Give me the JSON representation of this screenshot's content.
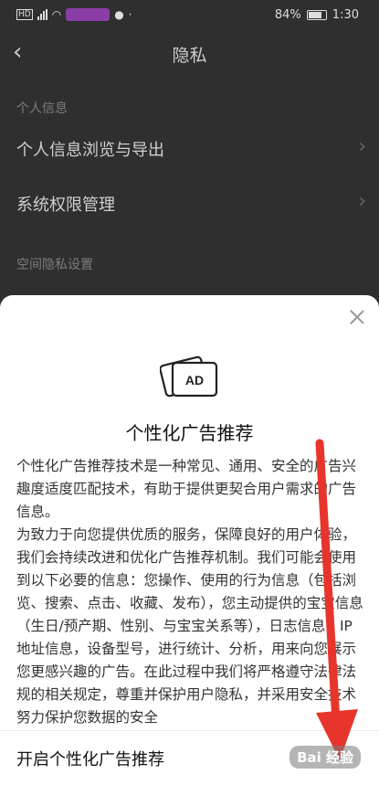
{
  "status": {
    "left_icons": [
      "hd-icon",
      "signal-icon",
      "wifi-icon"
    ],
    "battery": "84%",
    "time": "1:30"
  },
  "nav": {
    "title": "隐私"
  },
  "sections": {
    "personal_info_label": "个人信息",
    "personal_browse_export": "个人信息浏览与导出",
    "system_permission": "系统权限管理",
    "space_privacy_label": "空间隐私设置"
  },
  "sheet": {
    "icon_text": "AD",
    "title": "个性化广告推荐",
    "paragraph1": "个性化广告推荐技术是一种常见、通用、安全的广告兴趣度适度匹配技术，有助于提供更契合用户需求的广告信息。",
    "paragraph2": "为致力于向您提供优质的服务，保障良好的用户体验，我们会持续改进和优化广告推荐机制。我们可能会使用到以下必要的信息：您操作、使用的行为信息（包括浏览、搜索、点击、收藏、发布），您主动提供的宝宝信息（生日/预产期、性别、与宝宝关系等），日志信息，IP地址信息，设备型号，进行统计、分析，用来向您展示您更感兴趣的广告。在此过程中我们将严格遵守法律法规的相关规定，尊重并保护用户隐私，并采用安全技术努力保护您数据的安全",
    "toggle_label": "开启个性化广告推荐"
  },
  "watermark": "Bai 经验",
  "colors": {
    "annotation_arrow": "#e8352b",
    "dim_background": "#2f2f2f"
  }
}
